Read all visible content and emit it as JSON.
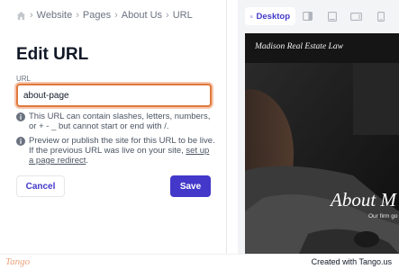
{
  "breadcrumb": {
    "items": [
      "Website",
      "Pages",
      "About Us",
      "URL"
    ]
  },
  "editor": {
    "title": "Edit URL",
    "field_label": "URL",
    "url_value": "about-page",
    "hint_rules": "This URL can contain slashes, letters, numbers, or + - _ but cannot start or end with /.",
    "hint_publish_prefix": "Preview or publish the site for this URL to be live. If the previous URL was live on your site,",
    "hint_publish_link": "set up a page redirect",
    "hint_publish_suffix": ".",
    "cancel_label": "Cancel",
    "save_label": "Save"
  },
  "device_toolbar": {
    "active_label": "Desktop",
    "icons": [
      "desktop-icon",
      "sidebar-layout-icon",
      "tablet-icon",
      "tablet-landscape-icon",
      "mobile-icon"
    ]
  },
  "preview": {
    "brand": "Madison Real Estate Law",
    "hero_title": "About M",
    "hero_subtitle": "Our firm go"
  },
  "footer": {
    "logo": "Tango",
    "created": "Created with Tango.us"
  },
  "colors": {
    "accent": "#4338ca",
    "input_focus_border": "#e0793b",
    "preview_bg": "#1d1d1d"
  }
}
